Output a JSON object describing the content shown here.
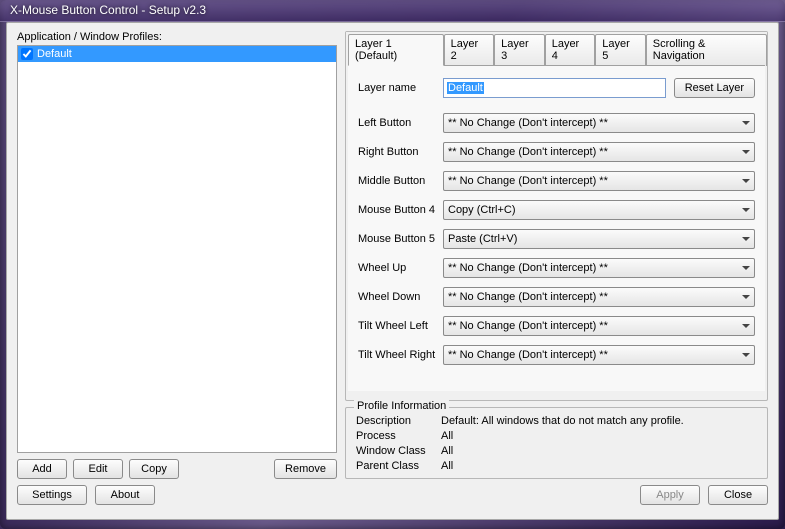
{
  "window": {
    "title": "X-Mouse Button Control - Setup v2.3"
  },
  "profiles": {
    "label": "Application / Window Profiles:",
    "items": [
      {
        "name": "Default",
        "checked": true
      }
    ],
    "buttons": {
      "add": "Add",
      "edit": "Edit",
      "copy": "Copy",
      "remove": "Remove"
    }
  },
  "tabs": [
    "Layer 1 (Default)",
    "Layer 2",
    "Layer 3",
    "Layer 4",
    "Layer 5",
    "Scrolling & Navigation"
  ],
  "layer": {
    "name_label": "Layer name",
    "name_value": "Default",
    "reset_label": "Reset Layer",
    "rows": [
      {
        "label": "Left Button",
        "value": "** No Change (Don't intercept) **"
      },
      {
        "label": "Right Button",
        "value": "** No Change (Don't intercept) **"
      },
      {
        "label": "Middle Button",
        "value": "** No Change (Don't intercept) **"
      },
      {
        "label": "Mouse Button 4",
        "value": "Copy (Ctrl+C)"
      },
      {
        "label": "Mouse Button 5",
        "value": "Paste (Ctrl+V)"
      },
      {
        "label": "Wheel Up",
        "value": "** No Change (Don't intercept) **"
      },
      {
        "label": "Wheel Down",
        "value": "** No Change (Don't intercept) **"
      },
      {
        "label": "Tilt Wheel Left",
        "value": "** No Change (Don't intercept) **"
      },
      {
        "label": "Tilt Wheel Right",
        "value": "** No Change (Don't intercept) **"
      }
    ]
  },
  "profile_info": {
    "legend": "Profile Information",
    "description_label": "Description",
    "description_value": "Default: All windows that do not match any profile.",
    "process_label": "Process",
    "process_value": "All",
    "window_class_label": "Window Class",
    "window_class_value": "All",
    "parent_class_label": "Parent Class",
    "parent_class_value": "All"
  },
  "footer": {
    "settings": "Settings",
    "about": "About",
    "apply": "Apply",
    "close": "Close"
  }
}
